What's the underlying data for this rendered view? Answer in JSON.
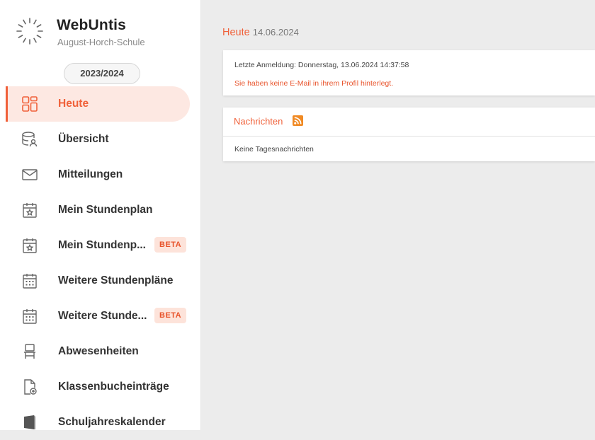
{
  "app": {
    "title": "WebUntis",
    "school": "August-Horch-Schule"
  },
  "school_year": "2023/2024",
  "nav": [
    {
      "label": "Heute",
      "icon": "dashboard-icon",
      "active": true
    },
    {
      "label": "Übersicht",
      "icon": "database-user-icon"
    },
    {
      "label": "Mitteilungen",
      "icon": "envelope-icon"
    },
    {
      "label": "Mein Stundenplan",
      "icon": "calendar-star-icon"
    },
    {
      "label": "Mein Stundenp...",
      "icon": "calendar-star-icon",
      "badge": "BETA"
    },
    {
      "label": "Weitere Stundenpläne",
      "icon": "calendar-grid-icon"
    },
    {
      "label": "Weitere Stunde...",
      "icon": "calendar-grid-icon",
      "badge": "BETA"
    },
    {
      "label": "Abwesenheiten",
      "icon": "chair-icon"
    },
    {
      "label": "Klassenbucheinträge",
      "icon": "document-add-icon"
    },
    {
      "label": "Schuljahreskalender",
      "icon": "book-icon"
    }
  ],
  "page": {
    "title": "Heute",
    "date": "14.06.2024"
  },
  "login_card": {
    "last_login": "Letzte Anmeldung: Donnerstag, 13.06.2024 14:37:58",
    "warning": "Sie haben keine E-Mail in ihrem Profil hinterlegt."
  },
  "news": {
    "title": "Nachrichten",
    "empty": "Keine Tagesnachrichten"
  },
  "colors": {
    "accent": "#f0613a",
    "active_bg": "#fde8e2",
    "beta_bg": "#fde3da",
    "main_bg": "#ececec"
  }
}
